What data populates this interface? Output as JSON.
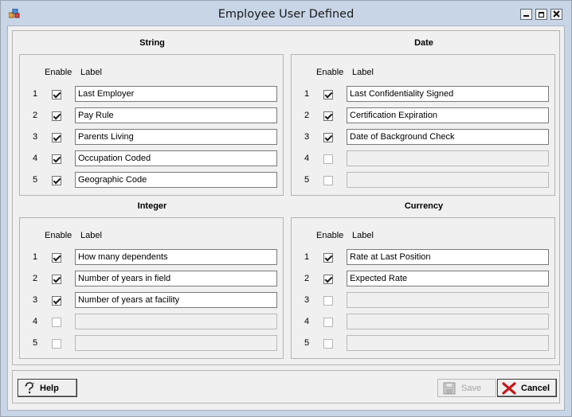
{
  "window": {
    "title": "Employee User Defined"
  },
  "columns": {
    "enable": "Enable",
    "label": "Label"
  },
  "sections": [
    {
      "title": "String",
      "rows": [
        {
          "n": "1",
          "checked": true,
          "value": "Last Employer"
        },
        {
          "n": "2",
          "checked": true,
          "value": "Pay Rule"
        },
        {
          "n": "3",
          "checked": true,
          "value": "Parents Living"
        },
        {
          "n": "4",
          "checked": true,
          "value": "Occupation Coded"
        },
        {
          "n": "5",
          "checked": true,
          "value": "Geographic Code"
        }
      ]
    },
    {
      "title": "Date",
      "rows": [
        {
          "n": "1",
          "checked": true,
          "value": "Last Confidentiality Signed"
        },
        {
          "n": "2",
          "checked": true,
          "value": "Certification Expiration"
        },
        {
          "n": "3",
          "checked": true,
          "value": "Date of Background Check"
        },
        {
          "n": "4",
          "checked": false,
          "value": ""
        },
        {
          "n": "5",
          "checked": false,
          "value": ""
        }
      ]
    },
    {
      "title": "Integer",
      "rows": [
        {
          "n": "1",
          "checked": true,
          "value": "How many dependents"
        },
        {
          "n": "2",
          "checked": true,
          "value": "Number of years in field"
        },
        {
          "n": "3",
          "checked": true,
          "value": "Number of years at facility"
        },
        {
          "n": "4",
          "checked": false,
          "value": ""
        },
        {
          "n": "5",
          "checked": false,
          "value": ""
        }
      ]
    },
    {
      "title": "Currency",
      "rows": [
        {
          "n": "1",
          "checked": true,
          "value": "Rate at Last Position"
        },
        {
          "n": "2",
          "checked": true,
          "value": "Expected Rate"
        },
        {
          "n": "3",
          "checked": false,
          "value": ""
        },
        {
          "n": "4",
          "checked": false,
          "value": ""
        },
        {
          "n": "5",
          "checked": false,
          "value": ""
        }
      ]
    }
  ],
  "buttons": {
    "help": "Help",
    "save": "Save",
    "cancel": "Cancel"
  },
  "icons": {
    "help": "question-icon",
    "save": "floppy-disk-icon",
    "cancel": "red-x-icon"
  }
}
